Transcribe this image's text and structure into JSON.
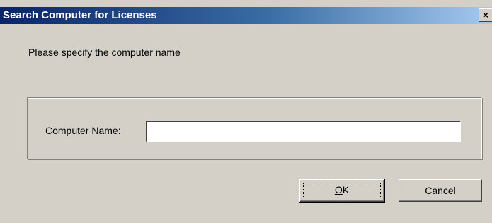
{
  "window": {
    "title": "Search Computer for Licenses",
    "close_glyph": "×"
  },
  "prompt": "Please specify the computer name",
  "form": {
    "computer_name_label": "Computer Name:",
    "computer_name_value": "",
    "computer_name_placeholder": ""
  },
  "buttons": {
    "ok": {
      "mnemonic": "O",
      "rest": "K"
    },
    "cancel": {
      "mnemonic": "C",
      "rest": "ancel"
    }
  },
  "colors": {
    "dialog_face": "#d4d0c8",
    "title_gradient_start": "#0a246a",
    "title_gradient_end": "#a6caf0",
    "title_text": "#ffffff"
  }
}
